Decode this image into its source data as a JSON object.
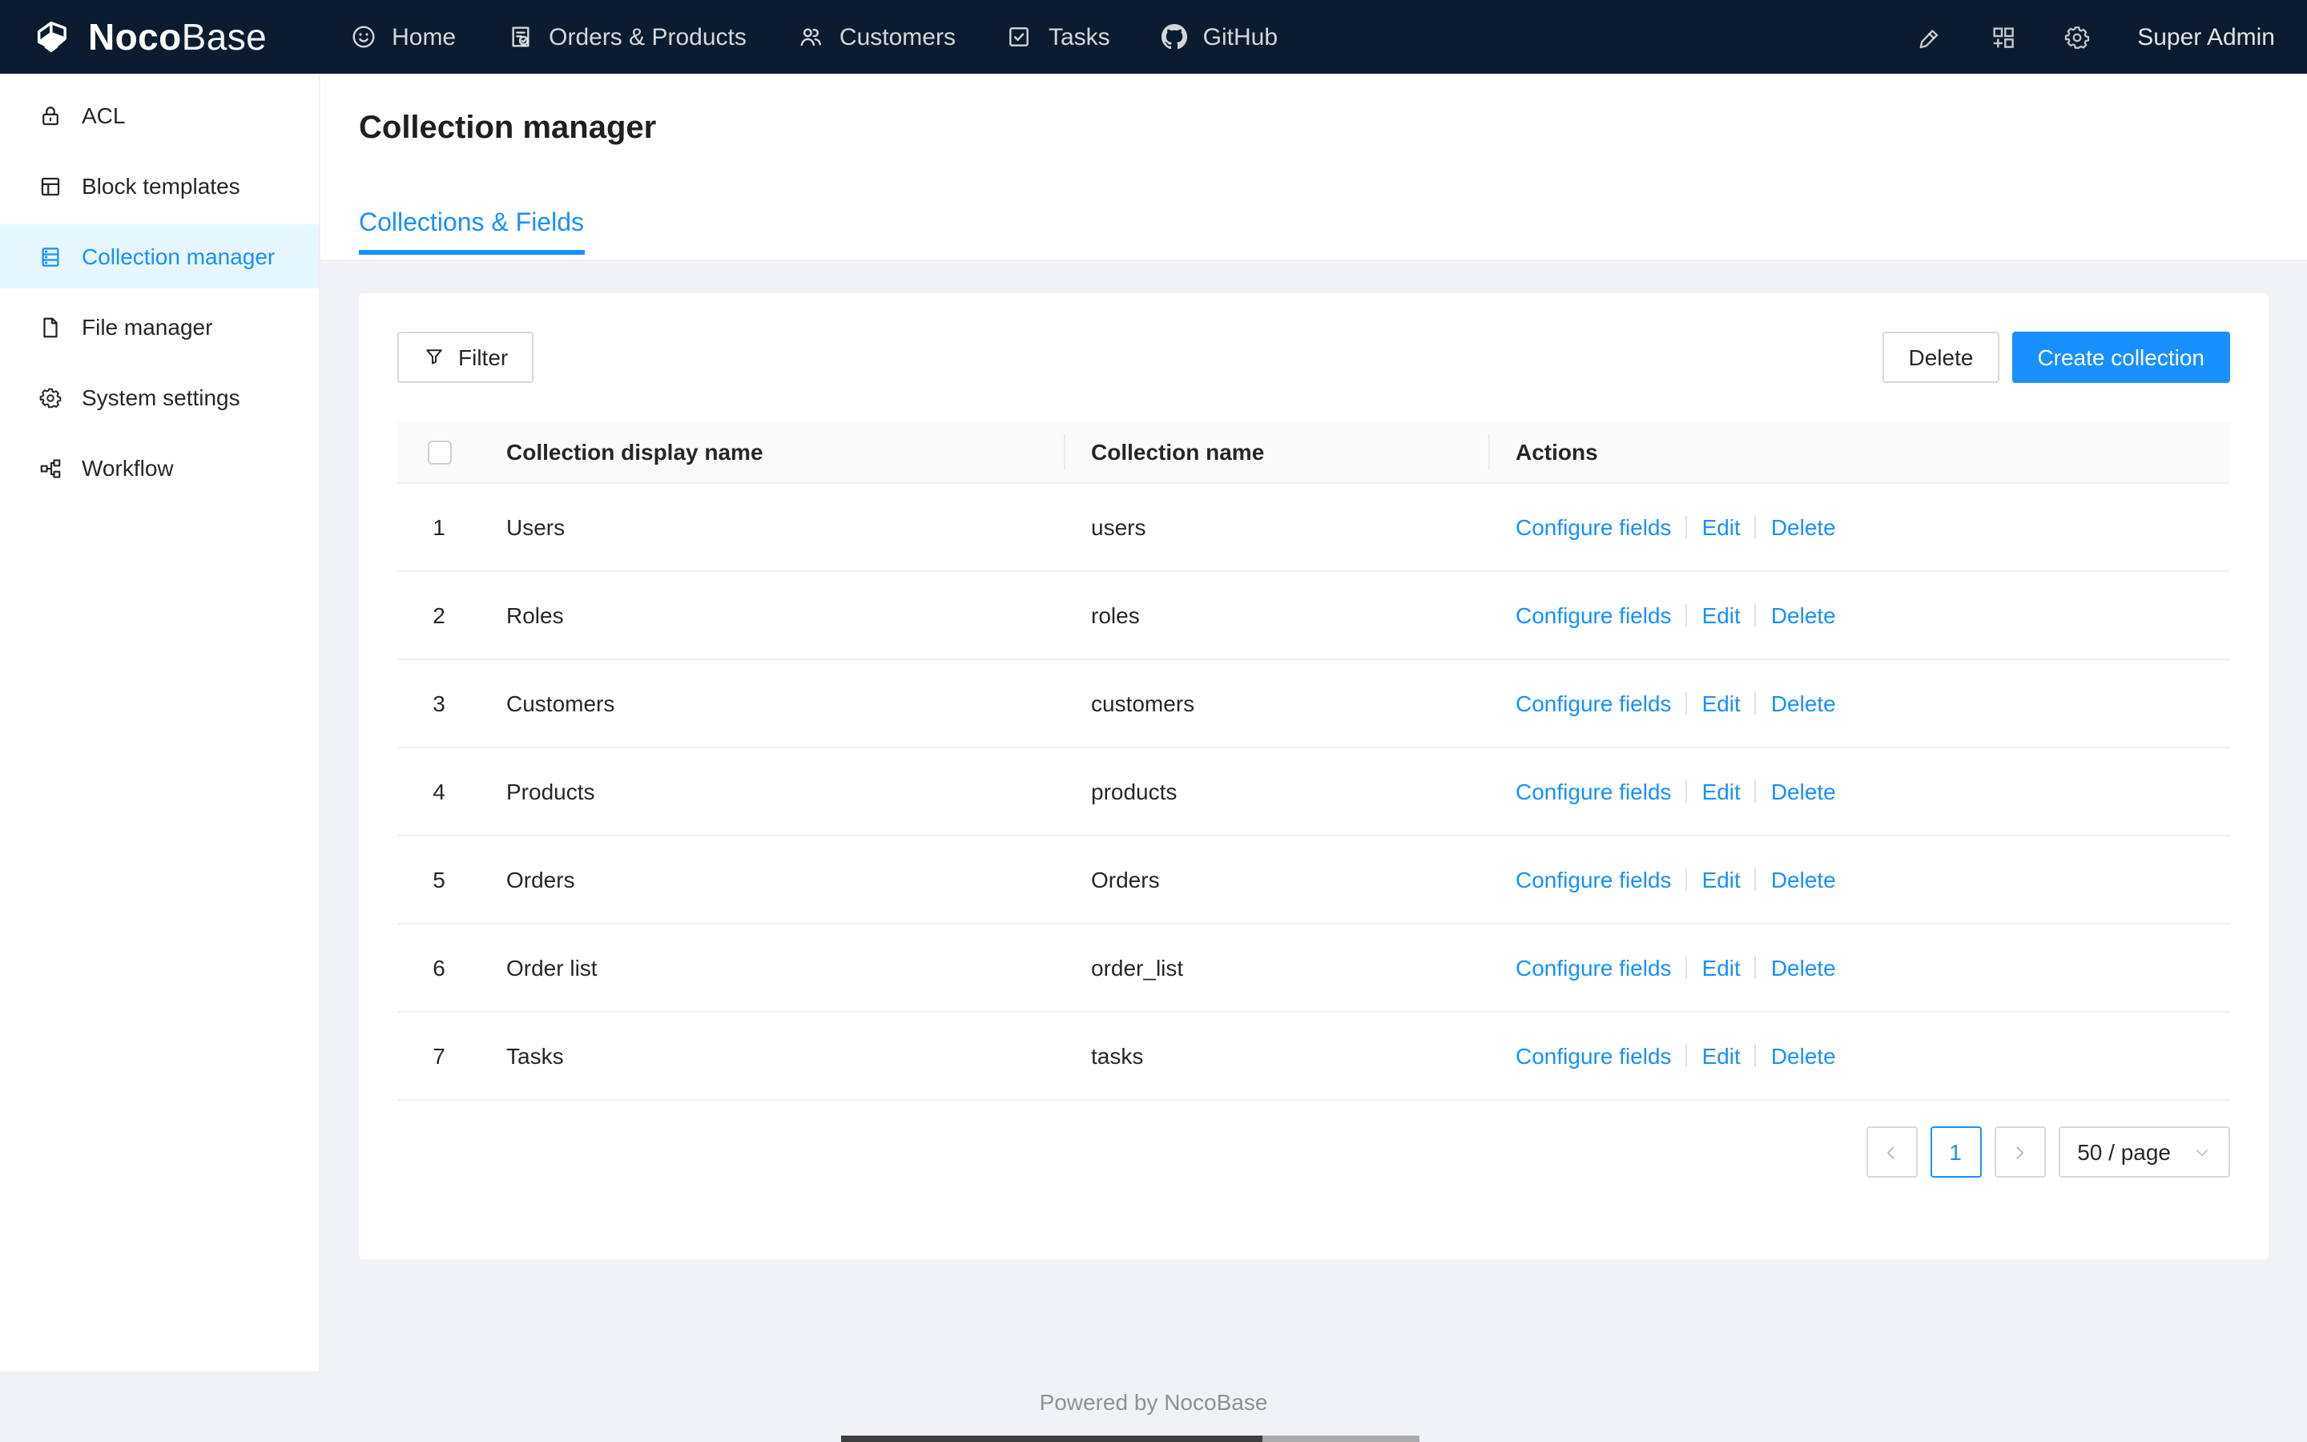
{
  "navbar": {
    "logo_primary": "Noco",
    "logo_secondary": "Base",
    "items": [
      {
        "label": "Home",
        "icon": "smile-icon"
      },
      {
        "label": "Orders & Products",
        "icon": "file-done-icon"
      },
      {
        "label": "Customers",
        "icon": "team-icon"
      },
      {
        "label": "Tasks",
        "icon": "check-square-icon"
      },
      {
        "label": "GitHub",
        "icon": "github-icon"
      }
    ],
    "user": "Super Admin"
  },
  "sidebar": {
    "items": [
      {
        "label": "ACL",
        "icon": "lock-icon"
      },
      {
        "label": "Block templates",
        "icon": "layout-icon"
      },
      {
        "label": "Collection manager",
        "icon": "database-icon"
      },
      {
        "label": "File manager",
        "icon": "file-icon"
      },
      {
        "label": "System settings",
        "icon": "gear-icon"
      },
      {
        "label": "Workflow",
        "icon": "workflow-icon"
      }
    ],
    "active_item": "Collection manager"
  },
  "page": {
    "title": "Collection manager",
    "active_tab": "Collections & Fields"
  },
  "toolbar": {
    "filter_label": "Filter",
    "delete_label": "Delete",
    "create_label": "Create collection"
  },
  "table": {
    "headers": {
      "display_name": "Collection display name",
      "name": "Collection name",
      "actions": "Actions"
    },
    "action_labels": [
      "Configure fields",
      "Edit",
      "Delete"
    ],
    "rows": [
      {
        "index": "1",
        "display_name": "Users",
        "name": "users"
      },
      {
        "index": "2",
        "display_name": "Roles",
        "name": "roles"
      },
      {
        "index": "3",
        "display_name": "Customers",
        "name": "customers"
      },
      {
        "index": "4",
        "display_name": "Products",
        "name": "products"
      },
      {
        "index": "5",
        "display_name": "Orders",
        "name": "Orders"
      },
      {
        "index": "6",
        "display_name": "Order list",
        "name": "order_list"
      },
      {
        "index": "7",
        "display_name": "Tasks",
        "name": "tasks"
      }
    ]
  },
  "pagination": {
    "current_page": "1",
    "page_size": "50 / page"
  },
  "footer": {
    "text": "Powered by NocoBase"
  },
  "colors": {
    "accent": "#1890ff",
    "navbar_bg": "#0c1c2e",
    "active_item_bg": "#e6f7ff",
    "content_bg": "#f0f2f5"
  }
}
